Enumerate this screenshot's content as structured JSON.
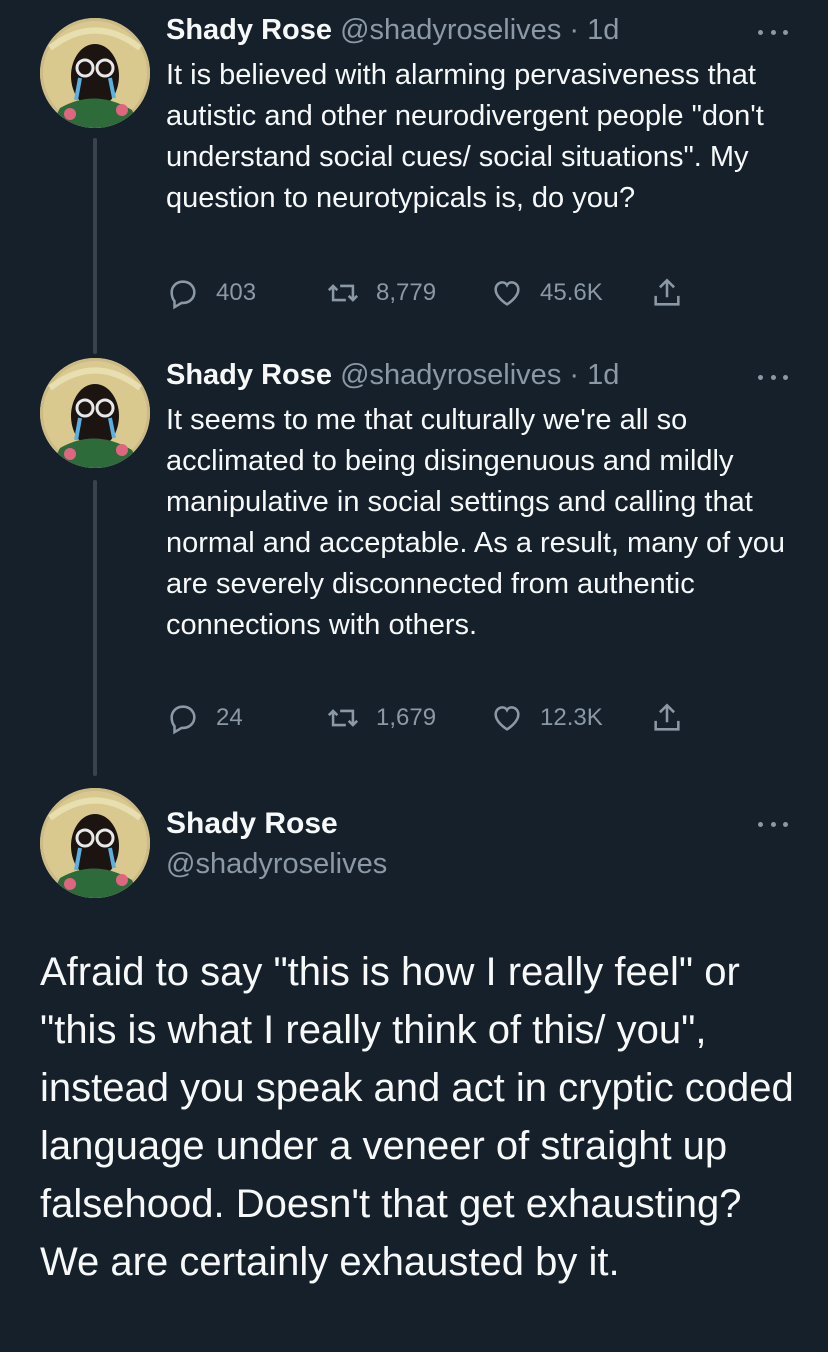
{
  "tweets": [
    {
      "name": "Shady Rose",
      "handle": "@shadyroselives",
      "dot": "·",
      "time": "1d",
      "text": "It is believed with alarming pervasiveness that autistic and other neurodivergent people \"don't understand social cues/ social situations\". My question to neurotypicals is, do you?",
      "replies": "403",
      "retweets": "8,779",
      "likes": "45.6K"
    },
    {
      "name": "Shady Rose",
      "handle": "@shadyroselives",
      "dot": "·",
      "time": "1d",
      "text": "It seems to me that culturally we're all so acclimated to being disingenuous and mildly manipulative in social settings and calling that normal and acceptable. As a result, many of you are severely disconnected from authentic connections with others.",
      "replies": "24",
      "retweets": "1,679",
      "likes": "12.3K"
    }
  ],
  "main": {
    "name": "Shady Rose",
    "handle": "@shadyroselives",
    "text": "Afraid to say \"this is how I really feel\" or \"this is what I really think of this/ you\", instead you speak and act in cryptic coded language under a veneer of straight up falsehood. Doesn't that get exhausting? We are certainly exhausted by it."
  },
  "icons": [
    "reply-icon",
    "retweet-icon",
    "like-icon",
    "share-icon",
    "more-icon",
    "avatar"
  ],
  "colors": {
    "background": "#15202b",
    "text": "#f7f9f9",
    "muted": "#8b98a5",
    "thread_line": "#38444d"
  }
}
